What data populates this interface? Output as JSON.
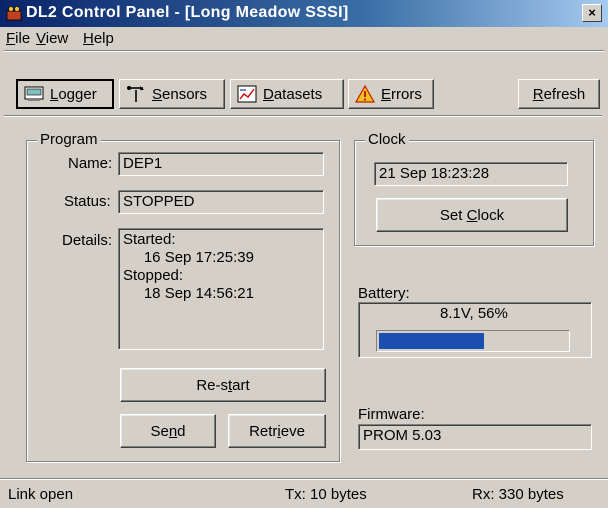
{
  "window": {
    "title": "DL2 Control Panel - [Long Meadow SSSI]",
    "close_glyph": "×"
  },
  "menu": [
    {
      "pre": "",
      "ul": "F",
      "post": "ile"
    },
    {
      "pre": "",
      "ul": "V",
      "post": "iew"
    },
    {
      "pre": "",
      "ul": "H",
      "post": "elp"
    }
  ],
  "toolbar": {
    "logger": {
      "ul": "L",
      "post": "ogger",
      "icon": "logger-icon"
    },
    "sensors": {
      "ul": "S",
      "post": "ensors",
      "icon": "sensor-icon"
    },
    "datasets": {
      "ul": "D",
      "post": "atasets",
      "icon": "datasets-icon"
    },
    "errors": {
      "ul": "E",
      "post": "rrors",
      "icon": "warning-icon"
    },
    "refresh": {
      "ul": "R",
      "post": "efresh"
    }
  },
  "program": {
    "group_label": "Program",
    "name_label": "Name:",
    "name_value": "DEP1",
    "status_label": "Status:",
    "status_value": "STOPPED",
    "details_label": "Details:",
    "details_value": "Started:\n     16 Sep 17:25:39\nStopped:\n     18 Sep 14:56:21",
    "restart": {
      "pre": "Re-s",
      "ul": "t",
      "post": "art"
    },
    "send": {
      "pre": "Se",
      "ul": "n",
      "post": "d"
    },
    "retrieve": {
      "pre": "Retr",
      "ul": "i",
      "post": "eve"
    }
  },
  "clock": {
    "group_label": "Clock",
    "value": "21 Sep 18:23:28",
    "set_clock": {
      "pre": "Set ",
      "ul": "C",
      "post": "lock"
    }
  },
  "battery": {
    "label": "Battery:",
    "text": "8.1V, 56%",
    "level_fraction": 0.56,
    "bar_color": "#1a4fb0"
  },
  "firmware": {
    "label": "Firmware:",
    "value": "PROM 5.03"
  },
  "statusbar": {
    "link": "Link open",
    "tx": "Tx: 10 bytes",
    "rx": "Rx: 330 bytes"
  }
}
